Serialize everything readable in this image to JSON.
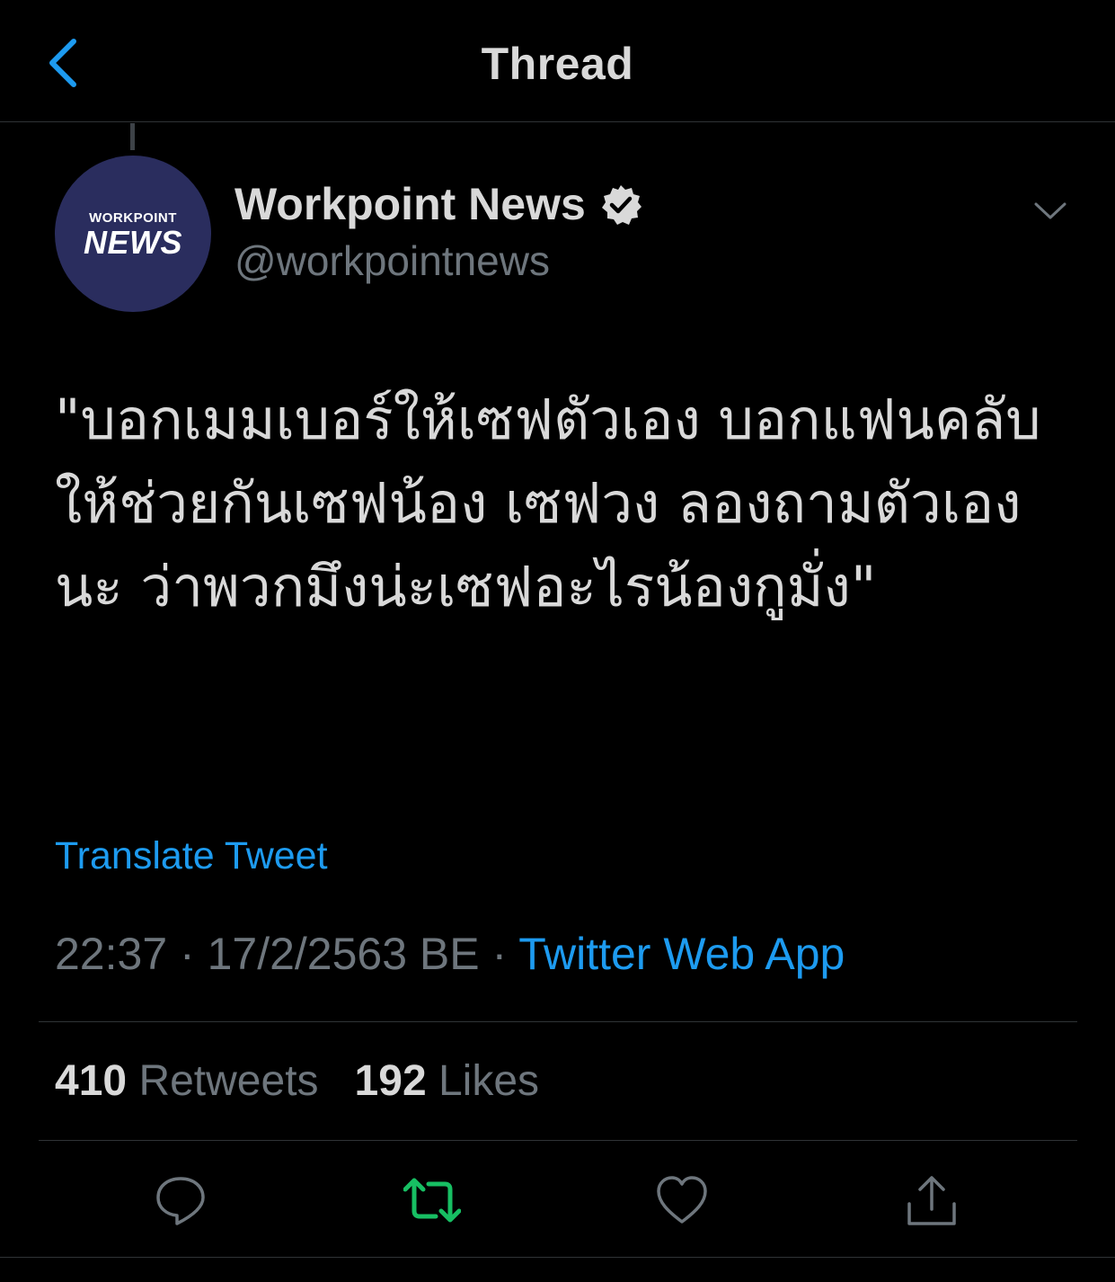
{
  "header": {
    "title": "Thread",
    "back_icon": "chevron-left-icon"
  },
  "colors": {
    "background": "#000000",
    "text": "#d9d9d9",
    "secondary_text": "#6e767d",
    "link": "#1d9bf0",
    "retweet_active": "#17bf63",
    "avatar_bg": "#2a2d5e"
  },
  "tweet": {
    "author": {
      "avatar_line1": "WORKPOINT",
      "avatar_line2": "NEWS",
      "display_name": "Workpoint News",
      "handle": "@workpointnews",
      "verified": true
    },
    "text": "\"บอกเมมเบอร์ให้เซฟตัวเอง บอกแฟนคลับ ให้ช่วยกันเซฟน้อง เซฟวง ลองถามตัวเองนะ ว่าพวกมึงน่ะเซฟอะไรน้องกูมั่ง\"",
    "translate_label": "Translate Tweet",
    "time": "22:37",
    "separator": "·",
    "date": "17/2/2563 BE",
    "source": "Twitter Web App",
    "retweets_count": "410",
    "retweets_label": "Retweets",
    "likes_count": "192",
    "likes_label": "Likes"
  },
  "actions": [
    {
      "icon": "reply-icon"
    },
    {
      "icon": "retweet-icon",
      "active": true
    },
    {
      "icon": "like-icon"
    },
    {
      "icon": "share-icon"
    }
  ]
}
